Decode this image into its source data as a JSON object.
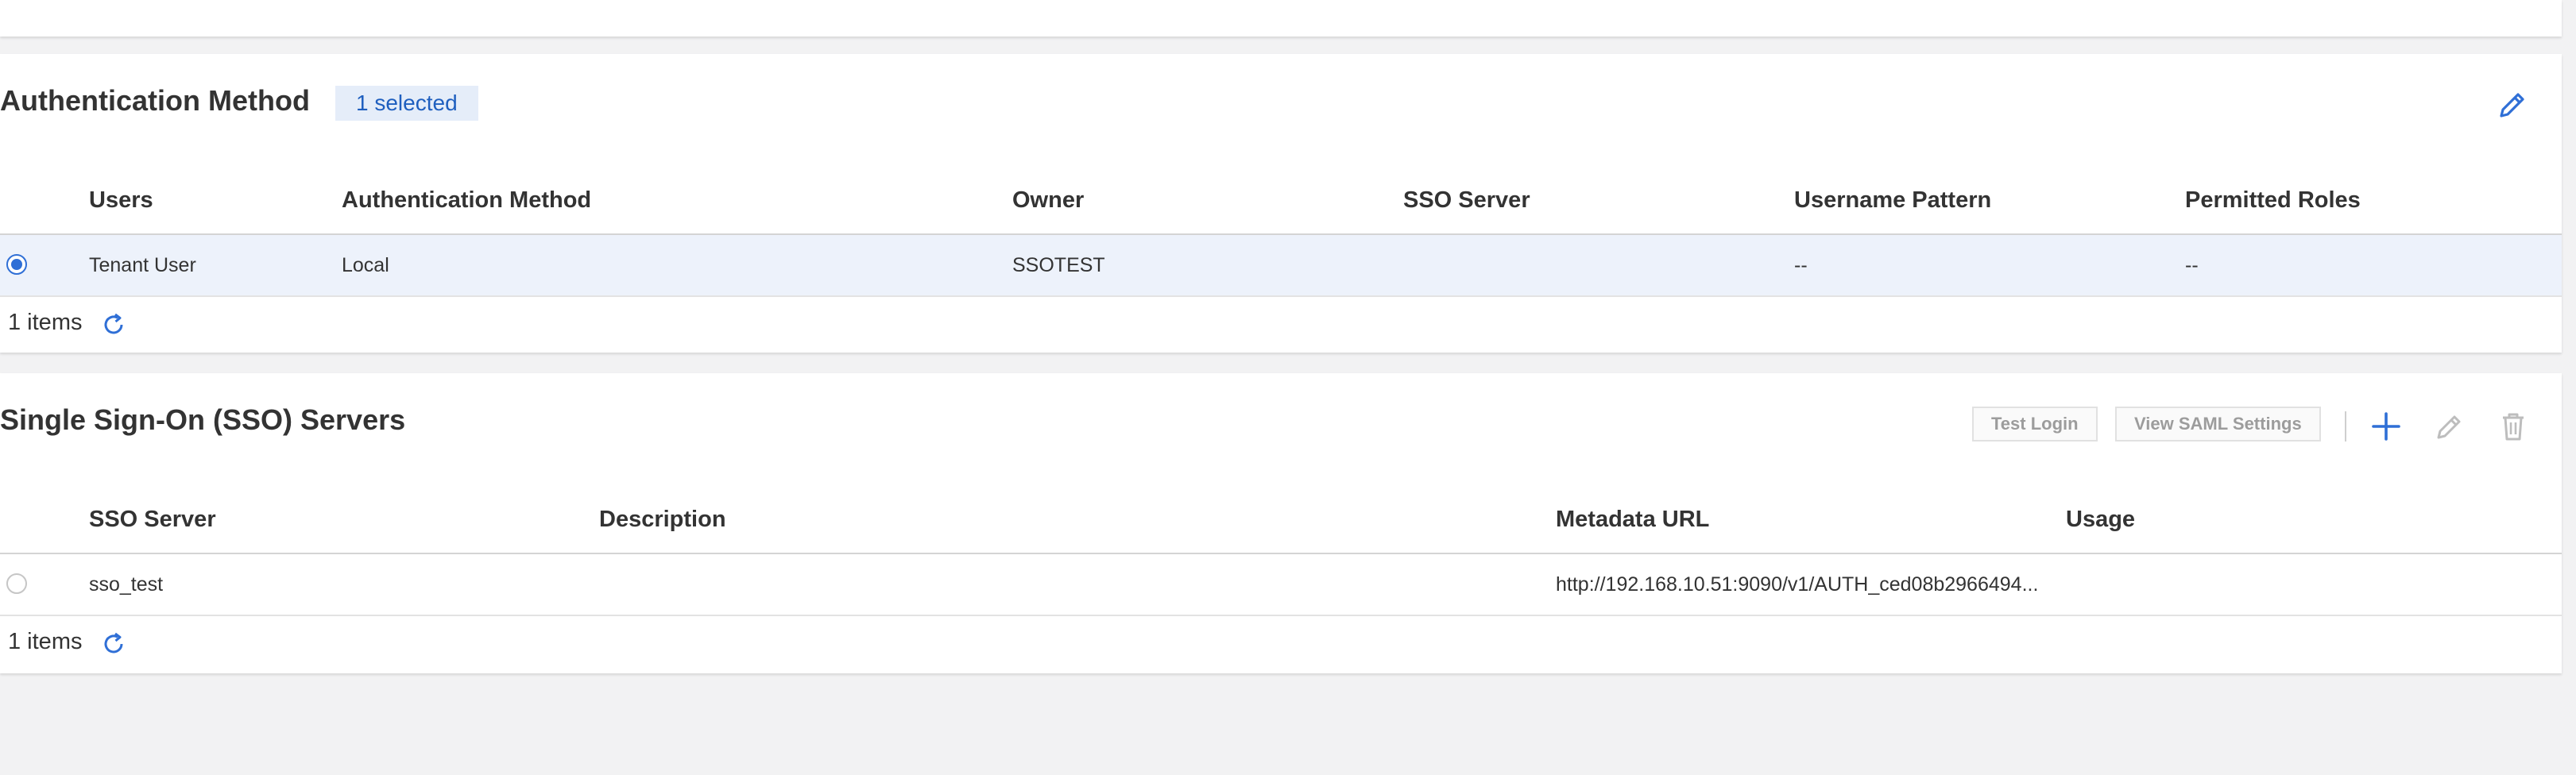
{
  "auth_card": {
    "title": "Authentication Method",
    "selected_badge": "1 selected",
    "columns": [
      "Users",
      "Authentication Method",
      "Owner",
      "SSO Server",
      "Username Pattern",
      "Permitted Roles"
    ],
    "rows": [
      {
        "selected": true,
        "cells": [
          "Tenant User",
          "Local",
          "SSOTEST",
          "",
          "--",
          "--"
        ]
      }
    ],
    "footer": {
      "count": "1 items"
    },
    "icons": {
      "edit": "pencil-icon",
      "refresh": "refresh-icon",
      "row_select": "radio-icon"
    }
  },
  "sso_card": {
    "title": "Single Sign-On (SSO) Servers",
    "toolbar": {
      "test_login": "Test Login",
      "view_saml": "View SAML Settings",
      "add_icon": "plus-icon",
      "edit_icon": "pencil-icon",
      "delete_icon": "trash-icon"
    },
    "columns": [
      "SSO Server",
      "Description",
      "Metadata URL",
      "Usage"
    ],
    "rows": [
      {
        "selected": false,
        "cells": [
          "sso_test",
          "",
          "http://192.168.10.51:9090/v1/AUTH_ced08b2966494...",
          ""
        ]
      }
    ],
    "footer": {
      "count": "1 items"
    }
  },
  "colors": {
    "accent": "#2f6fd6",
    "selected_row_bg": "#edf2fb",
    "badge_bg": "#e5edf9",
    "disabled_icon": "#bdbdbd",
    "page_bg": "#f2f2f3"
  }
}
